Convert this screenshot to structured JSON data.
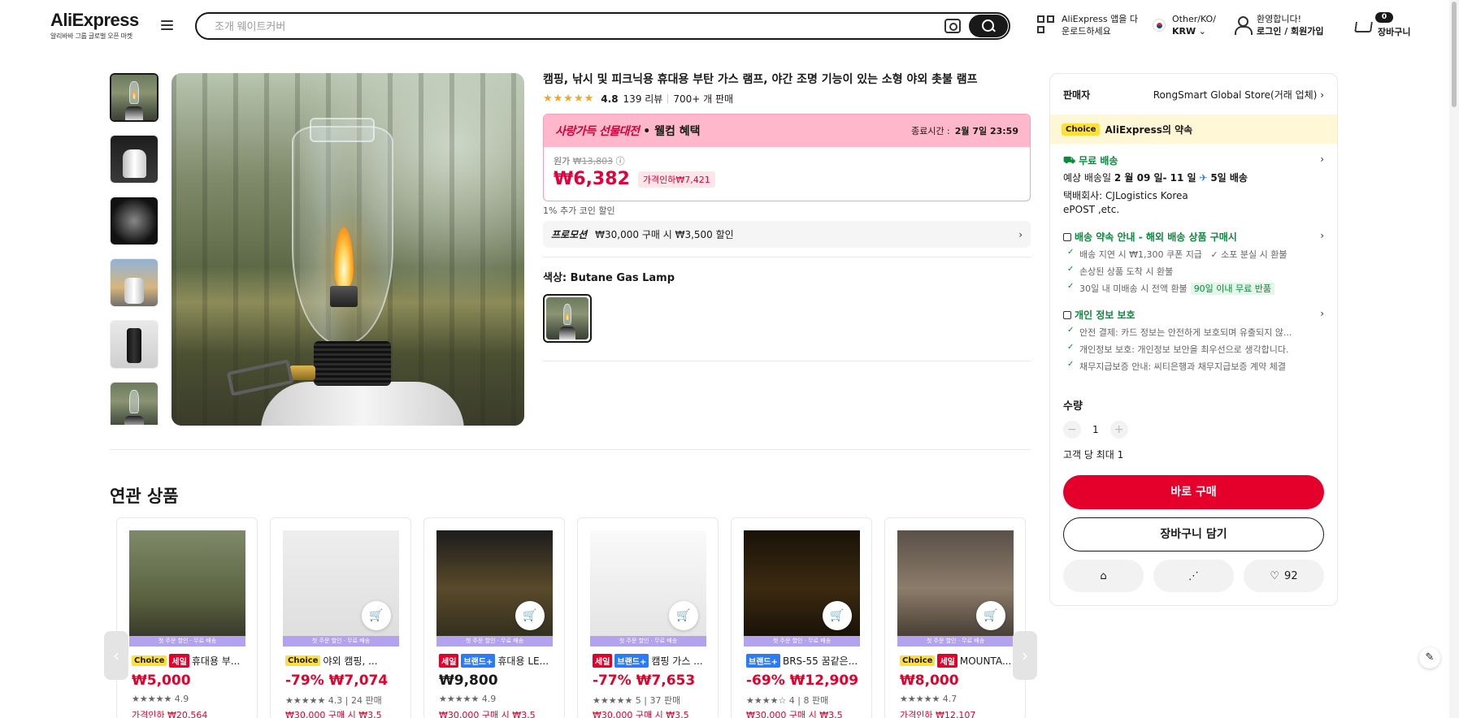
{
  "header": {
    "logo": "AliExpress",
    "logo_sub": "알리바바 그룹 글로벌 오픈 마켓",
    "search_placeholder": "조개 웨이트커버",
    "app_download": [
      "AliExpress 앱을 다",
      "운로드하세요"
    ],
    "locale_top": "Other/KO/",
    "locale_bottom": "KRW",
    "greeting": "환영합니다!",
    "login": "로그인 / 회원가입",
    "cart_label": "장바구니",
    "cart_count": "0"
  },
  "product": {
    "title": "캠핑, 낚시 및 피크닉용 휴대용 부탄 가스 램프, 야간 조명 기능이 있는 소형 야외 촛불 램프",
    "stars": "★★★★★",
    "rating": "4.8",
    "reviews": "139 리뷰",
    "sold": "700+ 개 판매",
    "promo_event": "사랑가득 선물대전",
    "promo_event_suffix": "• 웰컴 혜택",
    "end_time_label": "종료시간 :",
    "end_time": "2월 7일 23:59",
    "original_label": "원가",
    "original_price": "₩13,803",
    "price": "₩6,382",
    "discount": "가격인하₩7,421",
    "coin_note": "1% 추가 코인 할인",
    "promotion_label": "프로모션",
    "promotion_text": "₩30,000 구매 시 ₩3,500 할인",
    "color_label": "색상:",
    "color_value": "Butane Gas Lamp"
  },
  "panel": {
    "seller_label": "판매자",
    "seller_name": "RongSmart Global Store(거래 업체)",
    "choice_badge": "Choice",
    "choice_promise": "AliExpress의 약속",
    "free_shipping": "무료 배송",
    "delivery_label": "예상 배송일",
    "delivery_date": "2 월 09 일- 11 일",
    "delivery_days": "5일 배송",
    "carrier_label": "택배회사:",
    "carrier_1": "CJLogistics",
    "carrier_2": "Korea",
    "carrier_3": "ePOST ,etc.",
    "guarantee_title": "배송 약속 안내 - 해외 배송 상품 구매시",
    "guarantee_1": "배송 지연 시 ₩1,300 쿠폰 지급",
    "guarantee_1b": "소포 분실 시 환불",
    "guarantee_2": "손상된 상품 도착 시 환불",
    "guarantee_3": "30일 내 미배송 시 전액 환불",
    "guarantee_3_badge": "90일 이내 무료 반품",
    "privacy_title": "개인 정보 보호",
    "privacy_1": "안전 결제: 카드 정보는 안전하게 보호되며 유출되지 않...",
    "privacy_2": "개인정보 보호: 개인정보 보안을 최우선으로 생각합니다.",
    "privacy_3": "채무지급보증 안내: 씨티은행과 채무지급보증 계약 체결",
    "qty_label": "수량",
    "qty_value": "1",
    "qty_max": "고객 당 최대 1",
    "buy_now": "바로 구매",
    "add_cart": "장바구니 담기",
    "wish_count": "92"
  },
  "related": {
    "title": "연관 상품",
    "strip": "첫 주문 할인 · 무료 배송",
    "items": [
      {
        "tags": [
          "Choice",
          "세일"
        ],
        "name": "휴대용 부...",
        "price": "₩5,000",
        "rate": "★★★★★ 4.9",
        "extra": "가격인하 ₩20,564"
      },
      {
        "tags": [
          "Choice"
        ],
        "name": "야외 캠핑, ...",
        "price": "-79% ₩7,074",
        "rate": "★★★★★ 4.3 | 24 판매",
        "extra": "₩30,000 구매 시 ₩3,5"
      },
      {
        "tags": [
          "세일",
          "브랜드+"
        ],
        "name": "휴대용 LE...",
        "price": "₩9,800",
        "rate": "★★★★★ 4.9",
        "extra": "₩30,000 구매 시 ₩3,5"
      },
      {
        "tags": [
          "세일",
          "브랜드+"
        ],
        "name": "캠핑 가스 ...",
        "price": "-77% ₩7,653",
        "rate": "★★★★★ 5 | 37 판매",
        "extra": "₩30,000 구매 시 ₩3,5"
      },
      {
        "tags": [
          "브랜드+"
        ],
        "name": "BRS-55 꿈같은...",
        "price": "-69% ₩12,909",
        "rate": "★★★★☆ 4 | 8 판매",
        "extra": "₩30,000 구매 시 ₩3,5"
      },
      {
        "tags": [
          "Choice",
          "세일"
        ],
        "name": "MOUNTA...",
        "price": "₩8,000",
        "rate": "★★★★★ 4.7",
        "extra": "가격인하 ₩12,107"
      }
    ]
  }
}
